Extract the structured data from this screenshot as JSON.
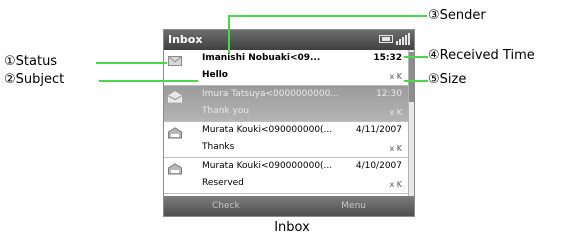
{
  "window": {
    "title": "Inbox"
  },
  "messages": [
    {
      "status_icon": "envelope-unread-icon",
      "sender": "Imanishi Nobuaki<09...",
      "subject": "Hello",
      "time": "15:32",
      "size": "x K"
    },
    {
      "status_icon": "envelope-read-icon",
      "sender": "Imura Tatsuya<0000000000...",
      "subject": "Thank you",
      "time": "12:30",
      "size": "x K"
    },
    {
      "status_icon": "envelope-sms-icon",
      "sender": "Murata Kouki<090000000(...",
      "subject": "Thanks",
      "time": "4/11/2007",
      "size": "x K"
    },
    {
      "status_icon": "envelope-sms-icon",
      "sender": "Murata Kouki<090000000(...",
      "subject": "Reserved",
      "time": "4/10/2007",
      "size": "x K"
    }
  ],
  "softkeys": {
    "left": "Check",
    "right": "Menu"
  },
  "callouts": {
    "status": "①Status",
    "subject": "②Subject",
    "sender": "③Sender",
    "received_time": "④Received Time",
    "size": "⑤Size"
  },
  "caption": "Inbox",
  "colors": {
    "callout_line": "#4cd64c",
    "highlight_row": "#a6a6a6",
    "titlebar": "#5a5a5a"
  }
}
